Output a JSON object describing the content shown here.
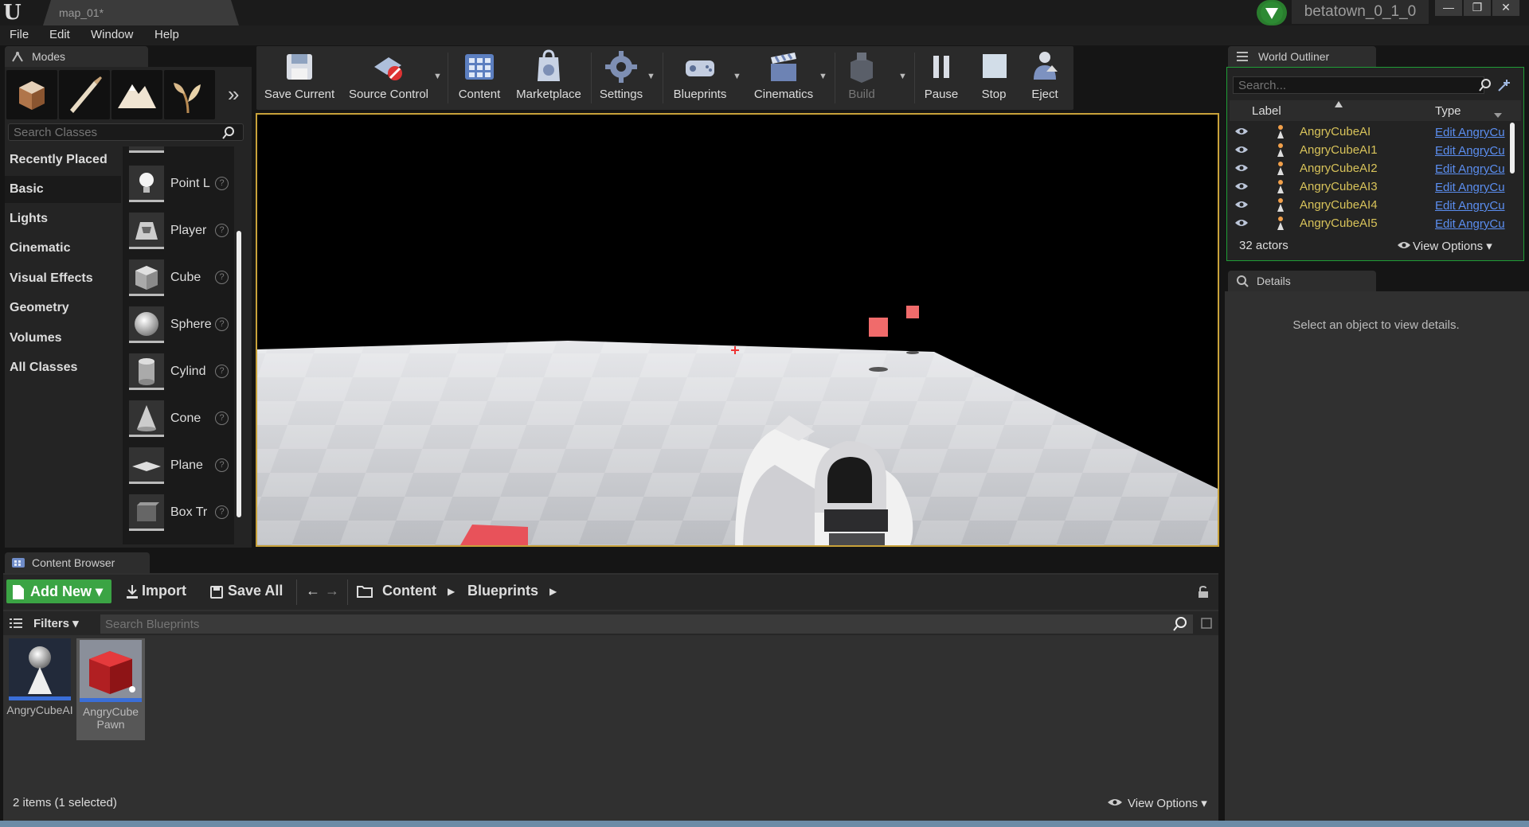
{
  "titlebar": {
    "logo": "U",
    "doc_tab": "map_01*",
    "project": "betatown_0_1_0",
    "minimize": "—",
    "restore": "❐",
    "close": "✕"
  },
  "menu": [
    "File",
    "Edit",
    "Window",
    "Help"
  ],
  "modes": {
    "tab_label": "Modes",
    "more": "»",
    "search_placeholder": "Search Classes",
    "categories": [
      "Recently Placed",
      "Basic",
      "Lights",
      "Cinematic",
      "Visual Effects",
      "Geometry",
      "Volumes",
      "All Classes"
    ],
    "active_category": "Basic",
    "classes": [
      "Point L",
      "Player",
      "Cube",
      "Sphere",
      "Cylind",
      "Cone",
      "Plane",
      "Box Tr"
    ],
    "help": "?"
  },
  "toolbar": {
    "buttons": [
      "Save Current",
      "Source Control",
      "Content",
      "Marketplace",
      "Settings",
      "Blueprints",
      "Cinematics",
      "Build",
      "Pause",
      "Stop",
      "Eject"
    ],
    "dropdown": "▼"
  },
  "outliner": {
    "tab_label": "World Outliner",
    "search_placeholder": "Search...",
    "col_label": "Label",
    "col_type": "Type",
    "rows": [
      {
        "name": "AngryCubeAI",
        "type": "Edit AngryCu"
      },
      {
        "name": "AngryCubeAI1",
        "type": "Edit AngryCu"
      },
      {
        "name": "AngryCubeAI2",
        "type": "Edit AngryCu"
      },
      {
        "name": "AngryCubeAI3",
        "type": "Edit AngryCu"
      },
      {
        "name": "AngryCubeAI4",
        "type": "Edit AngryCu"
      },
      {
        "name": "AngryCubeAI5",
        "type": "Edit AngryCu"
      }
    ],
    "count": "32 actors",
    "view_options": "View Options ▾"
  },
  "details": {
    "tab_label": "Details",
    "message": "Select an object to view details."
  },
  "content_browser": {
    "tab_label": "Content Browser",
    "add_new": "Add New ▾",
    "import": "Import",
    "save_all": "Save All",
    "back": "←",
    "forward": "→",
    "crumbs": [
      "Content",
      "Blueprints"
    ],
    "crumb_arrow": "▶",
    "filters": "Filters ▾",
    "search_placeholder": "Search Blueprints",
    "assets": [
      {
        "label": "AngryCubeAI"
      },
      {
        "label": "AngryCube Pawn"
      }
    ],
    "status": "2 items (1 selected)",
    "view_options": "View Options ▾"
  },
  "colors": {
    "selection_border": "#c8a23a",
    "add_new_green": "#3ba444",
    "outliner_name": "#d8c35a",
    "link_blue": "#5b8ef0",
    "enemy_cube": "#f06b6b"
  }
}
